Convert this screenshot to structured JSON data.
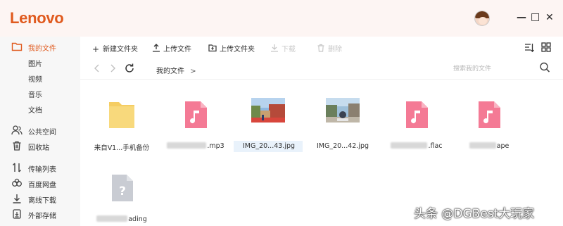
{
  "app": {
    "logo": "Lenovo"
  },
  "window": {
    "minimize": "—",
    "maximize": "□",
    "close": "✕"
  },
  "sidebar": {
    "items": [
      {
        "label": "我的文件",
        "icon": "folder-icon",
        "active": true
      },
      {
        "label": "图片"
      },
      {
        "label": "视频"
      },
      {
        "label": "音乐"
      },
      {
        "label": "文档"
      },
      {
        "label": "公共空间",
        "icon": "people-icon"
      },
      {
        "label": "回收站",
        "icon": "trash-icon"
      },
      {
        "label": "传输列表",
        "icon": "transfer-icon"
      },
      {
        "label": "百度网盘",
        "icon": "cloud-icon"
      },
      {
        "label": "离线下载",
        "icon": "download-icon"
      },
      {
        "label": "外部存储",
        "icon": "storage-icon"
      }
    ]
  },
  "toolbar": {
    "new_folder": "新建文件夹",
    "upload_file": "上传文件",
    "upload_folder": "上传文件夹",
    "download": "下载",
    "delete": "删除"
  },
  "nav": {
    "breadcrumb": "我的文件",
    "search_placeholder": "搜索我的文件"
  },
  "files": [
    {
      "name": "来自V1...手机备份",
      "type": "folder"
    },
    {
      "name": ".mp3",
      "type": "audio",
      "hidden_prefix": true
    },
    {
      "name": "IMG_20...43.jpg",
      "type": "image"
    },
    {
      "name": "IMG_20...42.jpg",
      "type": "image"
    },
    {
      "name": ".flac",
      "type": "audio",
      "hidden_prefix": true
    },
    {
      "name": "ape",
      "type": "audio",
      "hidden_prefix": true
    },
    {
      "name": "ading",
      "type": "unknown",
      "hidden_prefix": true
    }
  ],
  "watermark": "头条 @DGBest大玩家",
  "colors": {
    "accent": "#e05a1e",
    "audio": "#f47a95",
    "folder": "#f6d36c",
    "unknown": "#c9ccd3"
  }
}
